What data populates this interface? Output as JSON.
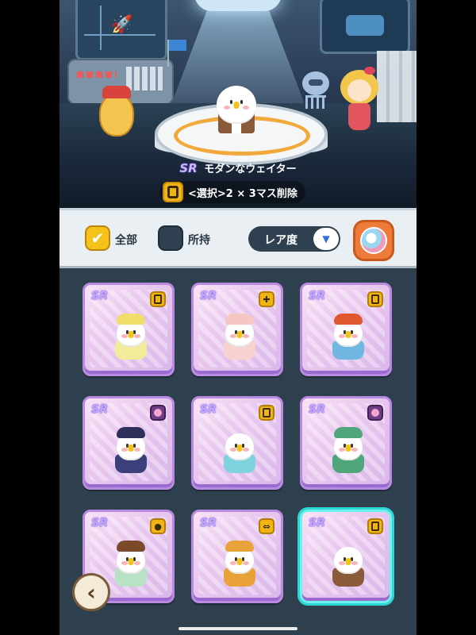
{
  "character": {
    "rarity": "SR",
    "name": "モダンなウェイター",
    "skill": "<選択>2 × 3マス削除"
  },
  "filter": {
    "all_label": "全部",
    "all_checked": true,
    "owned_label": "所持",
    "owned_checked": false,
    "sort_label": "レア度"
  },
  "cards": [
    {
      "rarity": "SR",
      "skill_icon": "square-skill-icon",
      "outfit": "yellow-helmet",
      "selected": false
    },
    {
      "rarity": "SR",
      "skill_icon": "cross-skill-icon",
      "outfit": "doctor-coat",
      "selected": false
    },
    {
      "rarity": "SR",
      "skill_icon": "square-skill-icon",
      "outfit": "painter",
      "selected": false
    },
    {
      "rarity": "SR",
      "skill_icon": "bud-skill-icon",
      "outfit": "qing-official",
      "selected": false
    },
    {
      "rarity": "SR",
      "skill_icon": "square-skill-icon",
      "outfit": "bathtub",
      "selected": false
    },
    {
      "rarity": "SR",
      "skill_icon": "bud-skill-icon",
      "outfit": "green-dragon",
      "selected": false
    },
    {
      "rarity": "SR",
      "skill_icon": "dots-skill-icon",
      "outfit": "ice-cream",
      "selected": false
    },
    {
      "rarity": "SR",
      "skill_icon": "lr-arrow-skill-icon",
      "outfit": "mushroom",
      "selected": false
    },
    {
      "rarity": "SR",
      "skill_icon": "square-skill-icon",
      "outfit": "modern-waiter",
      "selected": true
    }
  ],
  "colors": {
    "card_border": "#b98be0",
    "selected_border": "#6ef2f0",
    "skill_gold": "#f0b416",
    "panel_dark": "#2e3f4d"
  }
}
